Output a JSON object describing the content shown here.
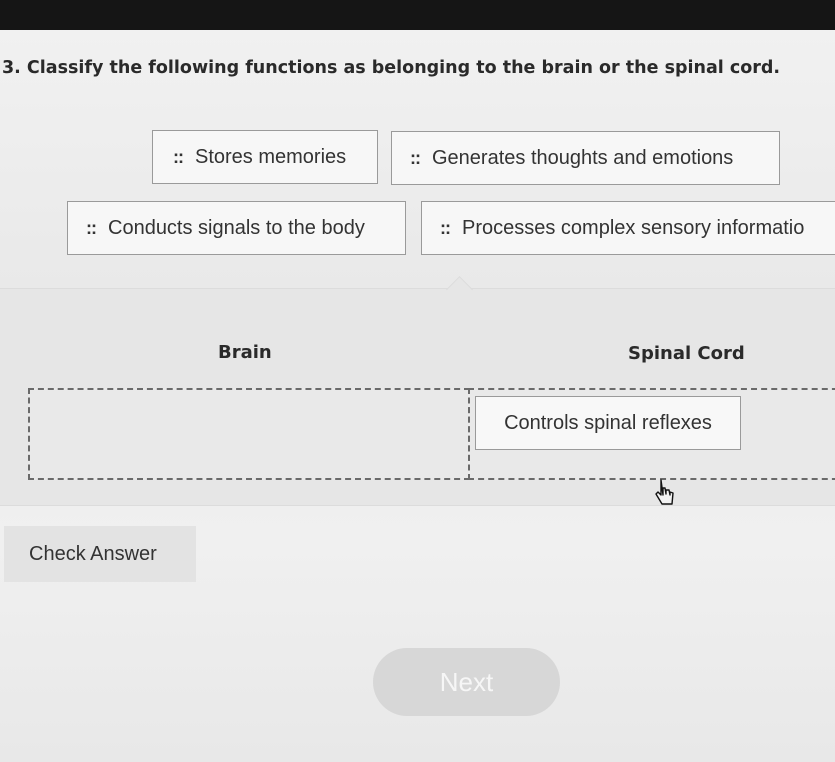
{
  "question": {
    "text": "3. Classify the following functions as belonging to the brain or the spinal cord."
  },
  "bank": {
    "items": [
      {
        "label": "Stores memories"
      },
      {
        "label": "Generates thoughts and emotions"
      },
      {
        "label": "Conducts signals to the body"
      },
      {
        "label": "Processes complex sensory informatio"
      }
    ],
    "grip_glyph": "::"
  },
  "categories": {
    "brain": {
      "heading": "Brain",
      "items": []
    },
    "spinal_cord": {
      "heading": "Spinal Cord",
      "items": [
        {
          "label": "Controls spinal reflexes"
        }
      ]
    }
  },
  "actions": {
    "check_answer_label": "Check Answer",
    "next_label": "Next"
  },
  "icons": {
    "grip": "drag-handle-icon",
    "cursor": "pointer-cursor-icon"
  }
}
